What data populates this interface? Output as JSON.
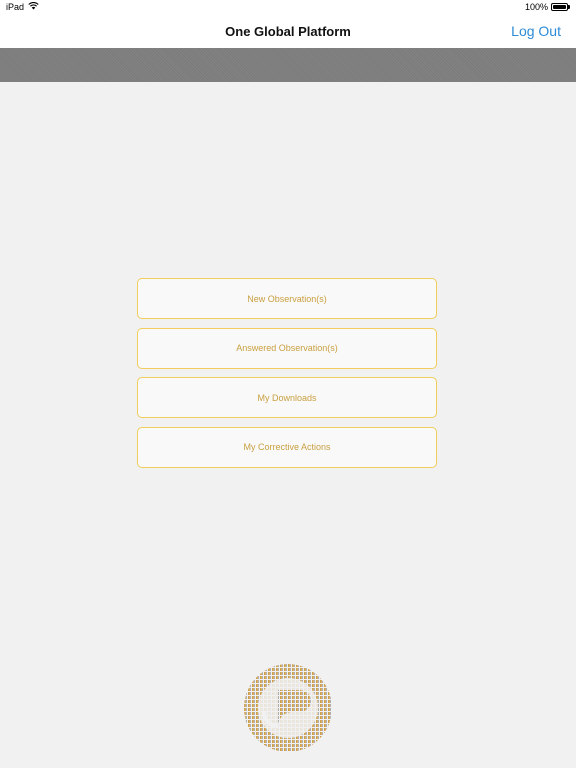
{
  "status_bar": {
    "device": "iPad",
    "battery": "100%"
  },
  "nav": {
    "title": "One Global Platform",
    "logout_label": "Log Out"
  },
  "menu": {
    "items": [
      {
        "label": "New Observation(s)"
      },
      {
        "label": "Answered Observation(s)"
      },
      {
        "label": "My Downloads"
      },
      {
        "label": "My Corrective Actions"
      }
    ]
  },
  "colors": {
    "accent_blue": "#2e8bd6",
    "button_border": "#f0cd5c",
    "button_text": "#c9a040",
    "logo_gold": "#c9953a",
    "logo_silver": "#a9a9a9"
  },
  "icons": {
    "wifi": "wifi-icon",
    "battery": "battery-icon",
    "logo": "app-logo"
  }
}
